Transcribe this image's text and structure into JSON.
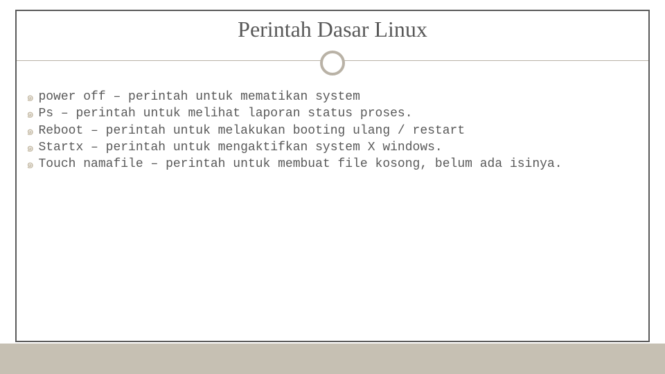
{
  "title": "Perintah Dasar Linux",
  "bullet_glyph": "๑",
  "items": [
    "power off – perintah untuk mematikan system",
    "Ps – perintah untuk melihat laporan status proses.",
    "Reboot – perintah untuk melakukan booting ulang / restart",
    "Startx – perintah untuk mengaktifkan system X windows.",
    "Touch namafile – perintah untuk membuat file kosong, belum ada isinya."
  ]
}
